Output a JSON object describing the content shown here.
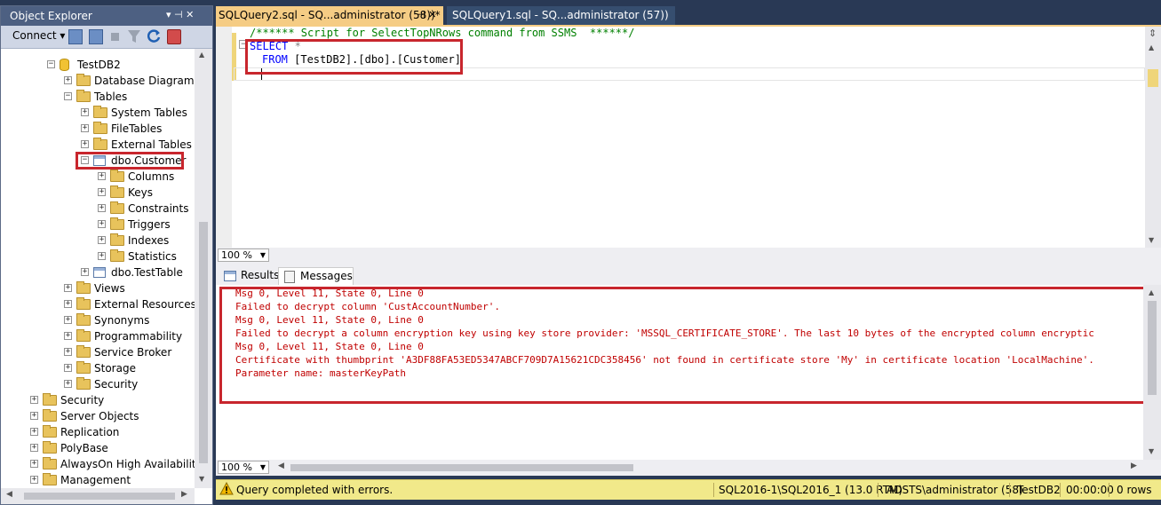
{
  "object_explorer": {
    "title": "Object Explorer",
    "pin_controls": "▾ ⊣ ✕",
    "connect_label": "Connect ▾",
    "tree": [
      {
        "label": "TestDB2",
        "depth": 3,
        "expander": "−",
        "icon": "database-icon"
      },
      {
        "label": "Database Diagrams",
        "depth": 4,
        "expander": "+",
        "icon": "folder-icon"
      },
      {
        "label": "Tables",
        "depth": 4,
        "expander": "−",
        "icon": "folder-icon"
      },
      {
        "label": "System Tables",
        "depth": 5,
        "expander": "+",
        "icon": "folder-icon"
      },
      {
        "label": "FileTables",
        "depth": 5,
        "expander": "+",
        "icon": "folder-icon"
      },
      {
        "label": "External Tables",
        "depth": 5,
        "expander": "+",
        "icon": "folder-icon"
      },
      {
        "label": "dbo.Customer",
        "depth": 5,
        "expander": "−",
        "icon": "table-icon",
        "highlighted": true
      },
      {
        "label": "Columns",
        "depth": 6,
        "expander": "+",
        "icon": "folder-icon"
      },
      {
        "label": "Keys",
        "depth": 6,
        "expander": "+",
        "icon": "folder-icon"
      },
      {
        "label": "Constraints",
        "depth": 6,
        "expander": "+",
        "icon": "folder-icon"
      },
      {
        "label": "Triggers",
        "depth": 6,
        "expander": "+",
        "icon": "folder-icon"
      },
      {
        "label": "Indexes",
        "depth": 6,
        "expander": "+",
        "icon": "folder-icon"
      },
      {
        "label": "Statistics",
        "depth": 6,
        "expander": "+",
        "icon": "folder-icon"
      },
      {
        "label": "dbo.TestTable",
        "depth": 5,
        "expander": "+",
        "icon": "table-icon"
      },
      {
        "label": "Views",
        "depth": 4,
        "expander": "+",
        "icon": "folder-icon"
      },
      {
        "label": "External Resources",
        "depth": 4,
        "expander": "+",
        "icon": "folder-icon"
      },
      {
        "label": "Synonyms",
        "depth": 4,
        "expander": "+",
        "icon": "folder-icon"
      },
      {
        "label": "Programmability",
        "depth": 4,
        "expander": "+",
        "icon": "folder-icon"
      },
      {
        "label": "Service Broker",
        "depth": 4,
        "expander": "+",
        "icon": "folder-icon"
      },
      {
        "label": "Storage",
        "depth": 4,
        "expander": "+",
        "icon": "folder-icon"
      },
      {
        "label": "Security",
        "depth": 4,
        "expander": "+",
        "icon": "folder-icon"
      },
      {
        "label": "Security",
        "depth": 2,
        "expander": "+",
        "icon": "folder-icon"
      },
      {
        "label": "Server Objects",
        "depth": 2,
        "expander": "+",
        "icon": "folder-icon"
      },
      {
        "label": "Replication",
        "depth": 2,
        "expander": "+",
        "icon": "folder-icon"
      },
      {
        "label": "PolyBase",
        "depth": 2,
        "expander": "+",
        "icon": "folder-icon"
      },
      {
        "label": "AlwaysOn High Availability",
        "depth": 2,
        "expander": "+",
        "icon": "folder-icon"
      },
      {
        "label": "Management",
        "depth": 2,
        "expander": "+",
        "icon": "folder-icon"
      }
    ]
  },
  "tabs": {
    "active": "SQLQuery2.sql - SQ...administrator (58))*",
    "active_controls": "⊣ ✕",
    "inactive": "SQLQuery1.sql - SQ...administrator (57))"
  },
  "editor": {
    "comment": "/****** Script for SelectTopNRows command from SSMS  ******/",
    "collapse_glyph": "−",
    "select_keyword": "SELECT",
    "select_rest": " *",
    "from_keyword": "FROM",
    "from_rest": " [TestDB2].[dbo].[Customer]",
    "zoom": "100 %"
  },
  "results": {
    "tab_results": "Results",
    "tab_messages": "Messages",
    "messages": [
      "Msg 0, Level 11, State 0, Line 0",
      "Failed to decrypt column 'CustAccountNumber'.",
      "Msg 0, Level 11, State 0, Line 0",
      "Failed to decrypt a column encryption key using key store provider: 'MSSQL_CERTIFICATE_STORE'. The last 10 bytes of the encrypted column encryptic",
      "Msg 0, Level 11, State 0, Line 0",
      "Certificate with thumbprint 'A3DF88FA53ED5347ABCF709D7A15621CDC358456' not found in certificate store 'My' in certificate location 'LocalMachine'.",
      "Parameter name: masterKeyPath"
    ],
    "zoom": "100 %"
  },
  "status": {
    "message": "Query completed with errors.",
    "server": "SQL2016-1\\SQL2016_1 (13.0 RTM)",
    "user": "ADSTS\\administrator (58)",
    "database": "TestDB2",
    "elapsed": "00:00:00",
    "rows": "0 rows"
  },
  "colors": {
    "accent": "#f5cc84",
    "error": "#c00000",
    "highlight": "#c8262d"
  }
}
